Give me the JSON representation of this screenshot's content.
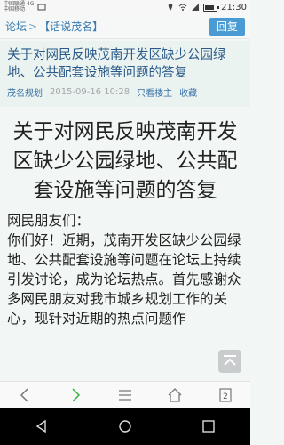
{
  "status_bar": {
    "carrier_line1": "中国联通 4G",
    "carrier_line2": "中国移动",
    "time": "21:30",
    "icons": [
      "message-icon",
      "location-icon",
      "wifi-icon",
      "signal-icon",
      "battery-icon"
    ]
  },
  "header": {
    "breadcrumb": [
      "论坛",
      "【话说茂名】"
    ],
    "separator": ">",
    "reply_label": "回复"
  },
  "post": {
    "title": "关于对网民反映茂南开发区缺少公园绿地、公共配套设施等问题的答复",
    "author": "茂名规划",
    "time": "2015-09-16 10:28",
    "only_author_label": "只看楼主",
    "favorite_label": "收藏"
  },
  "body": {
    "big_title": "关于对网民反映茂南开发区缺少公园绿地、公共配套设施等问题的答复",
    "greeting": "网民朋友们：",
    "text": "你们好！近期，茂南开发区缺少公园绿地、公共配套设施等问题在论坛上持续引发讨论，成为论坛热点。首先感谢众多网民朋友对我市城乡规划工作的关心，现针对近期的热点问题作"
  },
  "toolbar": {
    "icons": [
      "back-icon",
      "forward-icon",
      "menu-icon",
      "home-icon",
      "tabs-icon"
    ],
    "tabs_count": "2"
  },
  "colors": {
    "accent": "#4a9ad3",
    "link": "#3b72a8",
    "forward_green": "#3cb043"
  }
}
